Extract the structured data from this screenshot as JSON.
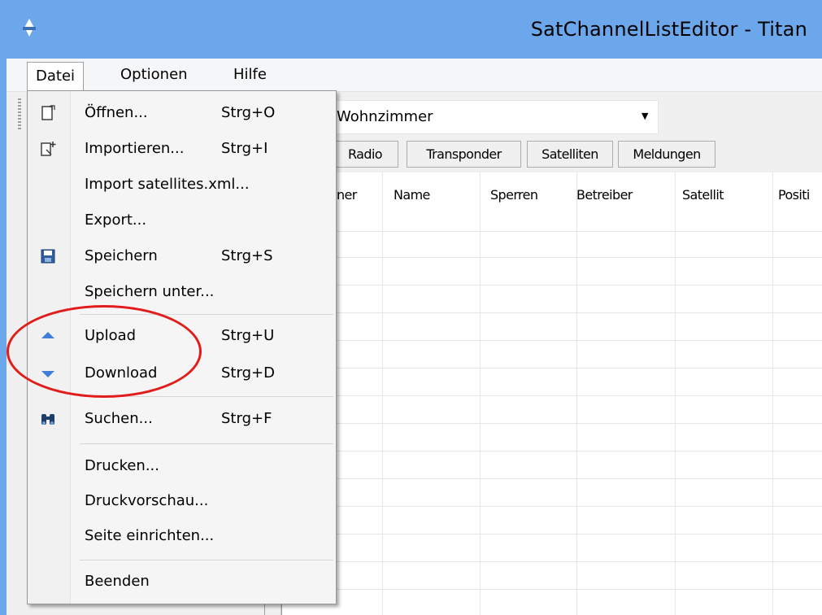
{
  "window": {
    "title": "SatChannelListEditor - Titan"
  },
  "menubar": {
    "items": [
      "Datei",
      "Optionen",
      "Hilfe"
    ]
  },
  "toolbar": {
    "profile_value": "Wohnzimmer"
  },
  "tabs": [
    "Radio",
    "Transponder",
    "Satelliten",
    "Meldungen"
  ],
  "grid": {
    "columns": [
      "ner",
      "Name",
      "Sperren",
      "Betreiber",
      "Satellit",
      "Positi"
    ]
  },
  "file_menu": {
    "items": [
      {
        "label": "Öffnen...",
        "shortcut": "Strg+O",
        "icon": "open-file-icon"
      },
      {
        "label": "Importieren...",
        "shortcut": "Strg+I",
        "icon": "import-icon"
      },
      {
        "label": "Import satellites.xml...",
        "shortcut": "",
        "icon": ""
      },
      {
        "label": "Export...",
        "shortcut": "",
        "icon": ""
      },
      {
        "label": "Speichern",
        "shortcut": "Strg+S",
        "icon": "save-icon"
      },
      {
        "label": "Speichern unter...",
        "shortcut": "",
        "icon": ""
      },
      {
        "label": "Upload",
        "shortcut": "Strg+U",
        "icon": "upload-arrow-icon"
      },
      {
        "label": "Download",
        "shortcut": "Strg+D",
        "icon": "download-arrow-icon"
      },
      {
        "label": "Suchen...",
        "shortcut": "Strg+F",
        "icon": "binoculars-icon"
      },
      {
        "label": "Drucken...",
        "shortcut": "",
        "icon": ""
      },
      {
        "label": "Druckvorschau...",
        "shortcut": "",
        "icon": ""
      },
      {
        "label": "Seite einrichten...",
        "shortcut": "",
        "icon": ""
      },
      {
        "label": "Beenden",
        "shortcut": "",
        "icon": ""
      }
    ]
  },
  "colors": {
    "titlebar": "#6ba7ea",
    "highlight": "#e21b1b",
    "arrow": "#3d7fd6"
  }
}
